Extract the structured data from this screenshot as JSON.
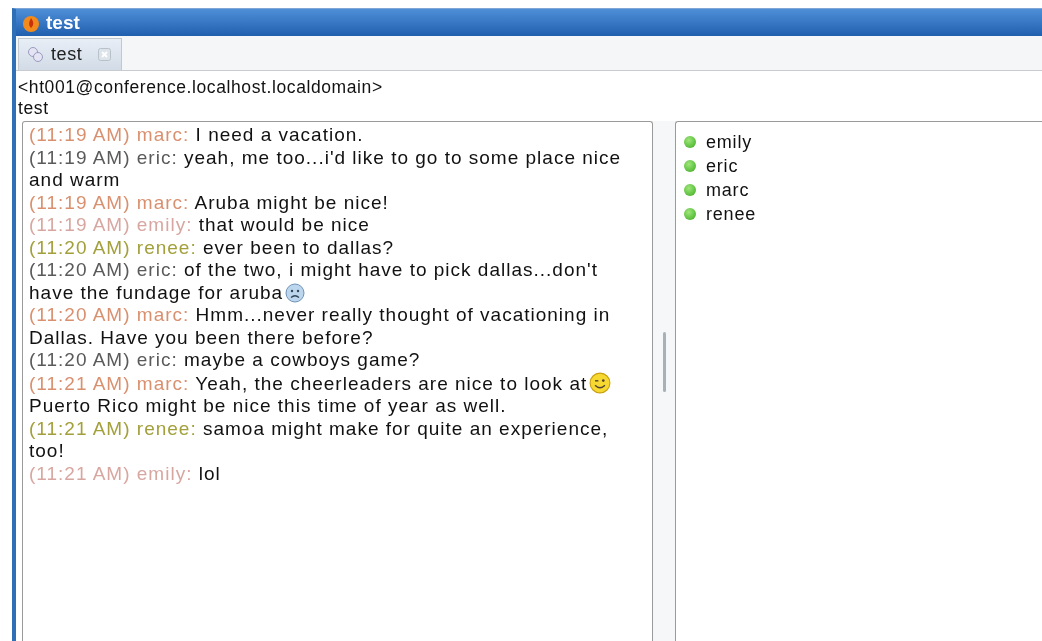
{
  "window": {
    "title": "test"
  },
  "tabs": [
    {
      "label": "test",
      "selected": true
    }
  ],
  "room": {
    "address": "<ht001@conference.localhost.localdomain>",
    "topic": "test"
  },
  "messages": [
    {
      "kind": "plain",
      "time": "(11:19 AM)",
      "nick": "marc:",
      "color": "#d9906f",
      "text": "I need a vacation."
    },
    {
      "kind": "plain",
      "time": "(11:19 AM)",
      "nick": "eric:",
      "color": "#5a5a5a",
      "text": "yeah, me too...i'd like to go to some place nice and warm"
    },
    {
      "kind": "plain",
      "time": "(11:19 AM)",
      "nick": "marc:",
      "color": "#d9906f",
      "text": "Aruba might be nice!"
    },
    {
      "kind": "plain",
      "time": "(11:19 AM)",
      "nick": "emily:",
      "color": "#d8a6a0",
      "text": "that would be nice"
    },
    {
      "kind": "plain",
      "time": "(11:20 AM)",
      "nick": "renee:",
      "color": "#a3a03c",
      "text": "ever been to dallas?"
    },
    {
      "kind": "sad-emoticon",
      "time": "(11:20 AM)",
      "nick": "eric:",
      "color": "#5a5a5a",
      "text": "of the two, i might have to pick dallas...don't",
      "continuation": "have the fundage for aruba"
    },
    {
      "kind": "plain",
      "time": "(11:20 AM)",
      "nick": "marc:",
      "color": "#d9906f",
      "text": "Hmm...never really thought of vacationing in Dallas.  Have you been there before?"
    },
    {
      "kind": "plain",
      "time": "(11:20 AM)",
      "nick": "eric:",
      "color": "#5a5a5a",
      "text": "maybe a cowboys game?"
    },
    {
      "kind": "wink-emoticon",
      "time": "(11:21 AM)",
      "nick": "marc:",
      "color": "#d9906f",
      "text": "Yeah, the cheerleaders are nice to look at",
      "continuation": "Puerto Rico might be nice this time of year as well."
    },
    {
      "kind": "plain",
      "time": "(11:21 AM)",
      "nick": "renee:",
      "color": "#a3a03c",
      "text": "samoa might make for quite an experience, too!"
    },
    {
      "kind": "plain",
      "time": "(11:21 AM)",
      "nick": "emily:",
      "color": "#d8a6a0",
      "text": "lol"
    }
  ],
  "occupants": [
    {
      "name": "emily"
    },
    {
      "name": "eric"
    },
    {
      "name": "marc"
    },
    {
      "name": "renee"
    }
  ]
}
